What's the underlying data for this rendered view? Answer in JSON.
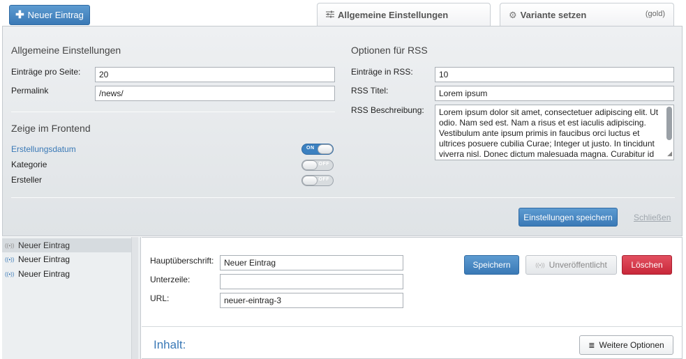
{
  "toolbar": {
    "new_entry_label": "Neuer Eintrag",
    "new_entry_icon": "plus-icon"
  },
  "tabs": [
    {
      "label": "Allgemeine Einstellungen",
      "icon": "sliders-icon"
    },
    {
      "label": "Variante setzen",
      "icon": "gear-icon",
      "badge": "(gold)"
    }
  ],
  "general": {
    "title": "Allgemeine Einstellungen",
    "per_page_label": "Einträge pro Seite:",
    "per_page_value": "20",
    "permalink_label": "Permalink",
    "permalink_value": "/news/"
  },
  "frontend": {
    "title": "Zeige im Frontend",
    "items": [
      {
        "label": "Erstellungsdatum",
        "state": "ON"
      },
      {
        "label": "Kategorie",
        "state": "OFF"
      },
      {
        "label": "Ersteller",
        "state": "OFF"
      }
    ]
  },
  "rss": {
    "title": "Optionen für RSS",
    "count_label": "Einträge in RSS:",
    "count_value": "10",
    "rss_title_label": "RSS Titel:",
    "rss_title_value": "Lorem ipsum",
    "description_label": "RSS Beschreibung:",
    "description_value": "Lorem ipsum dolor sit amet, consectetuer adipiscing elit. Ut odio. Nam sed est. Nam a risus et est iaculis adipiscing. Vestibulum ante ipsum primis in faucibus orci luctus et ultrices posuere cubilia Curae; Integer ut justo. In tincidunt viverra nisl. Donec dictum malesuada magna. Curabitur id nibh auctor tellus adipiscing pharetra. Fusce vel justo"
  },
  "settings_actions": {
    "save_label": "Einstellungen speichern",
    "close_label": "Schließen"
  },
  "entries": [
    {
      "label": "Neuer Eintrag"
    },
    {
      "label": "Neuer Eintrag"
    },
    {
      "label": "Neuer Eintrag"
    }
  ],
  "editor": {
    "headline_label": "Hauptüberschrift:",
    "headline_value": "Neuer Eintrag",
    "subline_label": "Unterzeile:",
    "subline_value": "",
    "url_label": "URL:",
    "url_value": "neuer-eintrag-3",
    "save_label": "Speichern",
    "unpublished_label": "Unveröffentlicht",
    "delete_label": "Löschen",
    "content_label": "Inhalt:",
    "more_options_label": "Weitere Optionen"
  },
  "colors": {
    "accent": "#3a79b6",
    "danger": "#c9283a"
  }
}
